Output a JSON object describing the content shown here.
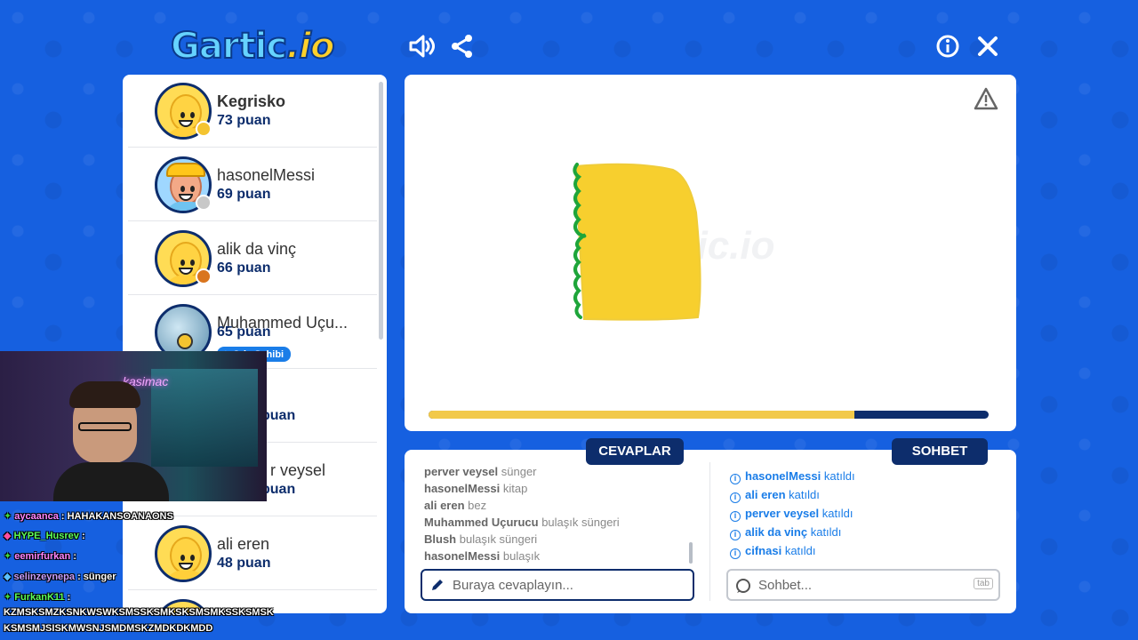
{
  "header": {
    "logo_main": "Gartic",
    "logo_suffix": ".io"
  },
  "players": [
    {
      "name": "Kegrisko",
      "points": "73 puan",
      "medal_color": "#f4c430"
    },
    {
      "name": "hasonelMessi",
      "points": "69 puan",
      "medal_color": "#c8c8c8"
    },
    {
      "name": "alik da vinç",
      "points": "66 puan",
      "medal_color": "#d9751e"
    },
    {
      "name": "Muhammed Uçu...",
      "points": "65 puan",
      "badge": "Oda Sahibi"
    },
    {
      "name": "",
      "points": "puan"
    },
    {
      "name": "r veysel",
      "points": "puan"
    },
    {
      "name": "ali eren",
      "points": "48 puan"
    }
  ],
  "answers": {
    "tab_label": "CEVAPLAR",
    "lines": [
      {
        "user": "perver veysel",
        "text": "sünger"
      },
      {
        "user": "hasonelMessi",
        "text": "kitap"
      },
      {
        "user": "ali eren",
        "text": "bez"
      },
      {
        "user": "Muhammed Uçurucu",
        "text": "bulaşık süngeri"
      },
      {
        "user": "Blush",
        "text": "bulaşık süngeri"
      },
      {
        "user": "hasonelMessi",
        "text": "bulaşık"
      }
    ],
    "input_placeholder": "Buraya cevaplayın..."
  },
  "chat": {
    "tab_label": "SOHBET",
    "lines": [
      {
        "user": "hasonelMessi",
        "text": "katıldı"
      },
      {
        "user": "ali eren",
        "text": "katıldı"
      },
      {
        "user": "perver veysel",
        "text": "katıldı"
      },
      {
        "user": "alik da vinç",
        "text": "katıldı"
      },
      {
        "user": "cifnasi",
        "text": "katıldı"
      }
    ],
    "input_placeholder": "Sohbet...",
    "tab_key": "tab"
  },
  "canvas": {
    "watermark": "Gartic.io",
    "timer_progress": 0.76,
    "drawing_fill": "#f7cf2e",
    "drawing_edge": "#1ea53a"
  },
  "stream_overlay": {
    "webcam_neon_text": "kasimac",
    "chat": [
      {
        "user": "aycaanca",
        "text": ": HAHAKANSOANAONS"
      },
      {
        "user": "HYPE_Husrev",
        "text": ":"
      },
      {
        "user": "eemirfurkan",
        "text": ":"
      },
      {
        "user": "selinzeynepa",
        "text": ": sünger"
      },
      {
        "user": "FurkanK11",
        "text": ":"
      },
      {
        "user": "",
        "text": "KZMSKSMZKSNKWSWKSMSSKSMKSKSMSMKSSKSMSK"
      },
      {
        "user": "",
        "text": "KSMSMJSISKMWSNJSMDMSKZMDKDKMDD"
      }
    ]
  },
  "colors": {
    "background": "#1660e0",
    "navy": "#0d2d6c",
    "link_blue": "#1a7de8"
  }
}
